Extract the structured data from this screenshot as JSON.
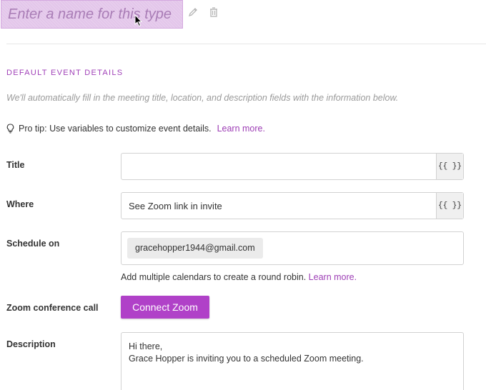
{
  "header": {
    "name_placeholder": "Enter a name for this type",
    "pencil_icon": "pencil-icon",
    "trash_icon": "trash-icon"
  },
  "section": {
    "title": "DEFAULT EVENT DETAILS",
    "description": "We'll automatically fill in the meeting title, location, and description fields with the information below."
  },
  "tip": {
    "icon": "lightbulb-icon",
    "text": "Pro tip: Use variables to customize event details.",
    "link": "Learn more."
  },
  "fields": {
    "title": {
      "label": "Title",
      "value": "",
      "var_button": "{{ }}"
    },
    "where": {
      "label": "Where",
      "value": "See Zoom link in invite",
      "var_button": "{{ }}"
    },
    "schedule": {
      "label": "Schedule on",
      "calendars": [
        "gracehopper1944@gmail.com"
      ],
      "help_text": "Add multiple calendars to create a round robin.",
      "help_link": "Learn more."
    },
    "zoom": {
      "label": "Zoom conference call",
      "button": "Connect Zoom"
    },
    "description": {
      "label": "Description",
      "line1": "Hi there,",
      "line2": "Grace Hopper is inviting you to a scheduled Zoom meeting."
    }
  },
  "colors": {
    "accent": "#b041c8",
    "link": "#9d3db5",
    "name_input_bg": "#e3c6ea"
  }
}
